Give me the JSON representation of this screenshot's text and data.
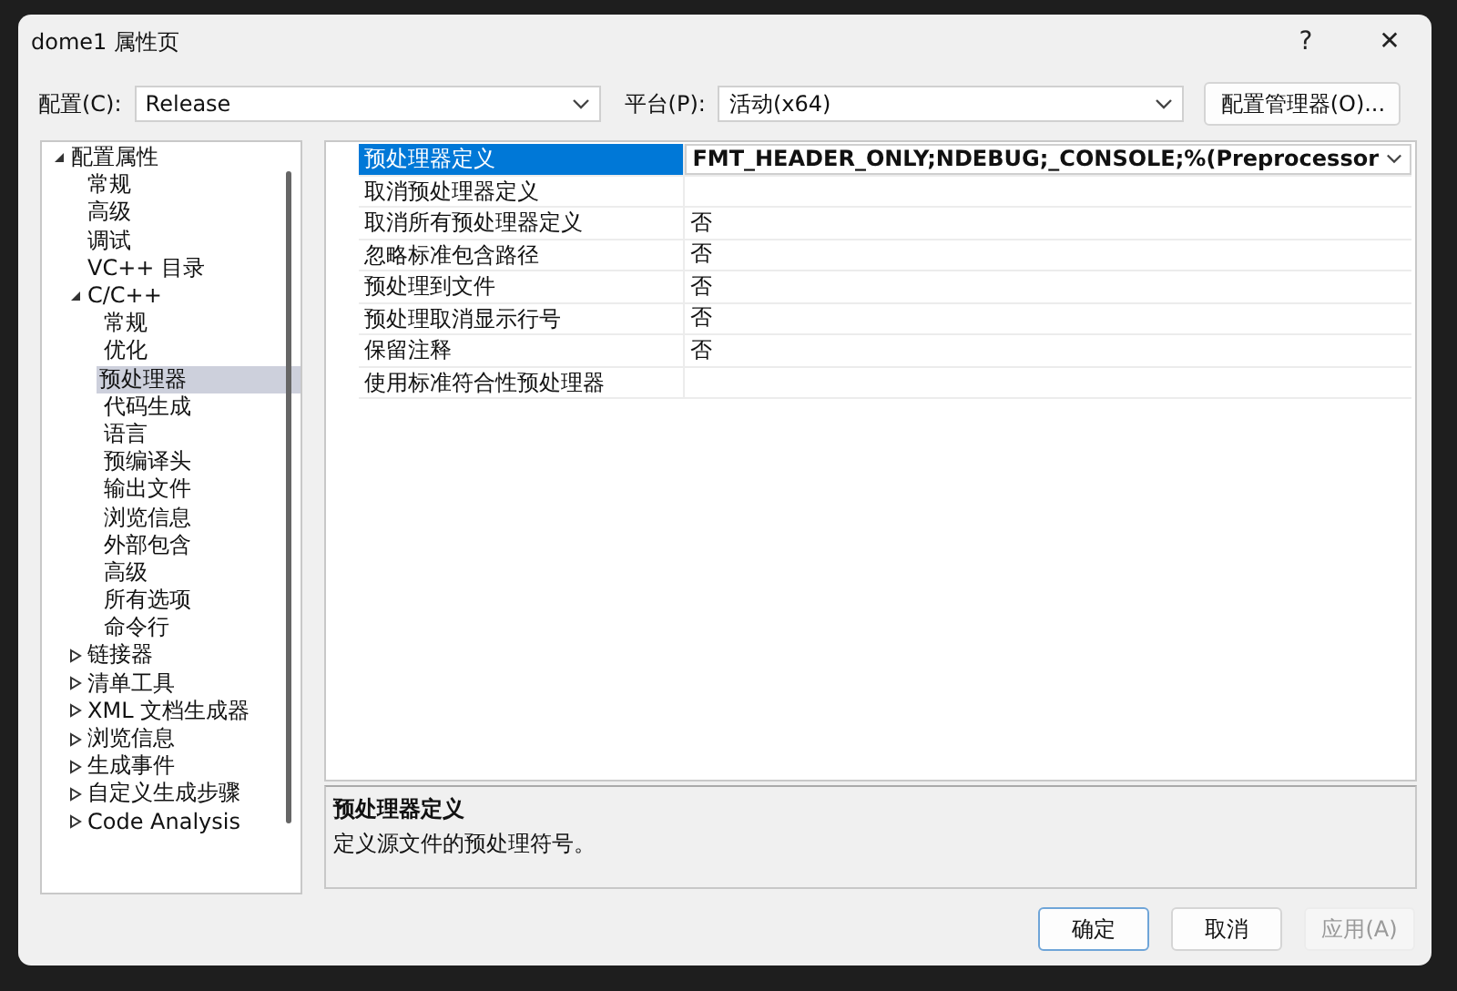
{
  "window": {
    "title": "dome1 属性页",
    "help": "?",
    "close": "✕"
  },
  "config": {
    "label": "配置(C):",
    "value": "Release"
  },
  "platform": {
    "label": "平台(P):",
    "value": "活动(x64)"
  },
  "config_manager": "配置管理器(O)...",
  "tree": [
    {
      "label": "配置属性",
      "expanded": true,
      "selected": false,
      "children": [
        {
          "label": "常规",
          "selected": false
        },
        {
          "label": "高级",
          "selected": false
        },
        {
          "label": "调试",
          "selected": false
        },
        {
          "label": "VC++ 目录",
          "selected": false
        },
        {
          "label": "C/C++",
          "expanded": true,
          "selected": false,
          "children": [
            {
              "label": "常规",
              "selected": false
            },
            {
              "label": "优化",
              "selected": false
            },
            {
              "label": "预处理器",
              "selected": true
            },
            {
              "label": "代码生成",
              "selected": false
            },
            {
              "label": "语言",
              "selected": false
            },
            {
              "label": "预编译头",
              "selected": false
            },
            {
              "label": "输出文件",
              "selected": false
            },
            {
              "label": "浏览信息",
              "selected": false
            },
            {
              "label": "外部包含",
              "selected": false
            },
            {
              "label": "高级",
              "selected": false
            },
            {
              "label": "所有选项",
              "selected": false
            },
            {
              "label": "命令行",
              "selected": false
            }
          ]
        },
        {
          "label": "链接器",
          "expanded": false,
          "selected": false
        },
        {
          "label": "清单工具",
          "expanded": false,
          "selected": false
        },
        {
          "label": "XML 文档生成器",
          "expanded": false,
          "selected": false
        },
        {
          "label": "浏览信息",
          "expanded": false,
          "selected": false
        },
        {
          "label": "生成事件",
          "expanded": false,
          "selected": false
        },
        {
          "label": "自定义生成步骤",
          "expanded": false,
          "selected": false
        },
        {
          "label": "Code Analysis",
          "expanded": false,
          "selected": false
        }
      ]
    }
  ],
  "properties": [
    {
      "name": "预处理器定义",
      "value": "FMT_HEADER_ONLY;NDEBUG;_CONSOLE;%(Preprocessor",
      "selected": true
    },
    {
      "name": "取消预处理器定义",
      "selected": false
    },
    {
      "name": "取消所有预处理器定义",
      "value": "否",
      "selected": false
    },
    {
      "name": "忽略标准包含路径",
      "value": "否",
      "selected": false
    },
    {
      "name": "预处理到文件",
      "value": "否",
      "selected": false
    },
    {
      "name": "预处理取消显示行号",
      "value": "否",
      "selected": false
    },
    {
      "name": "保留注释",
      "value": "否",
      "selected": false
    },
    {
      "name": "使用标准符合性预处理器",
      "selected": false
    }
  ],
  "description": {
    "title": "预处理器定义",
    "text": "定义源文件的预处理符号。"
  },
  "buttons": [
    {
      "label": "确定",
      "disabled": false,
      "default": true
    },
    {
      "label": "取消",
      "disabled": false,
      "default": false
    },
    {
      "label": "应用(A)",
      "disabled": true,
      "default": false
    }
  ]
}
